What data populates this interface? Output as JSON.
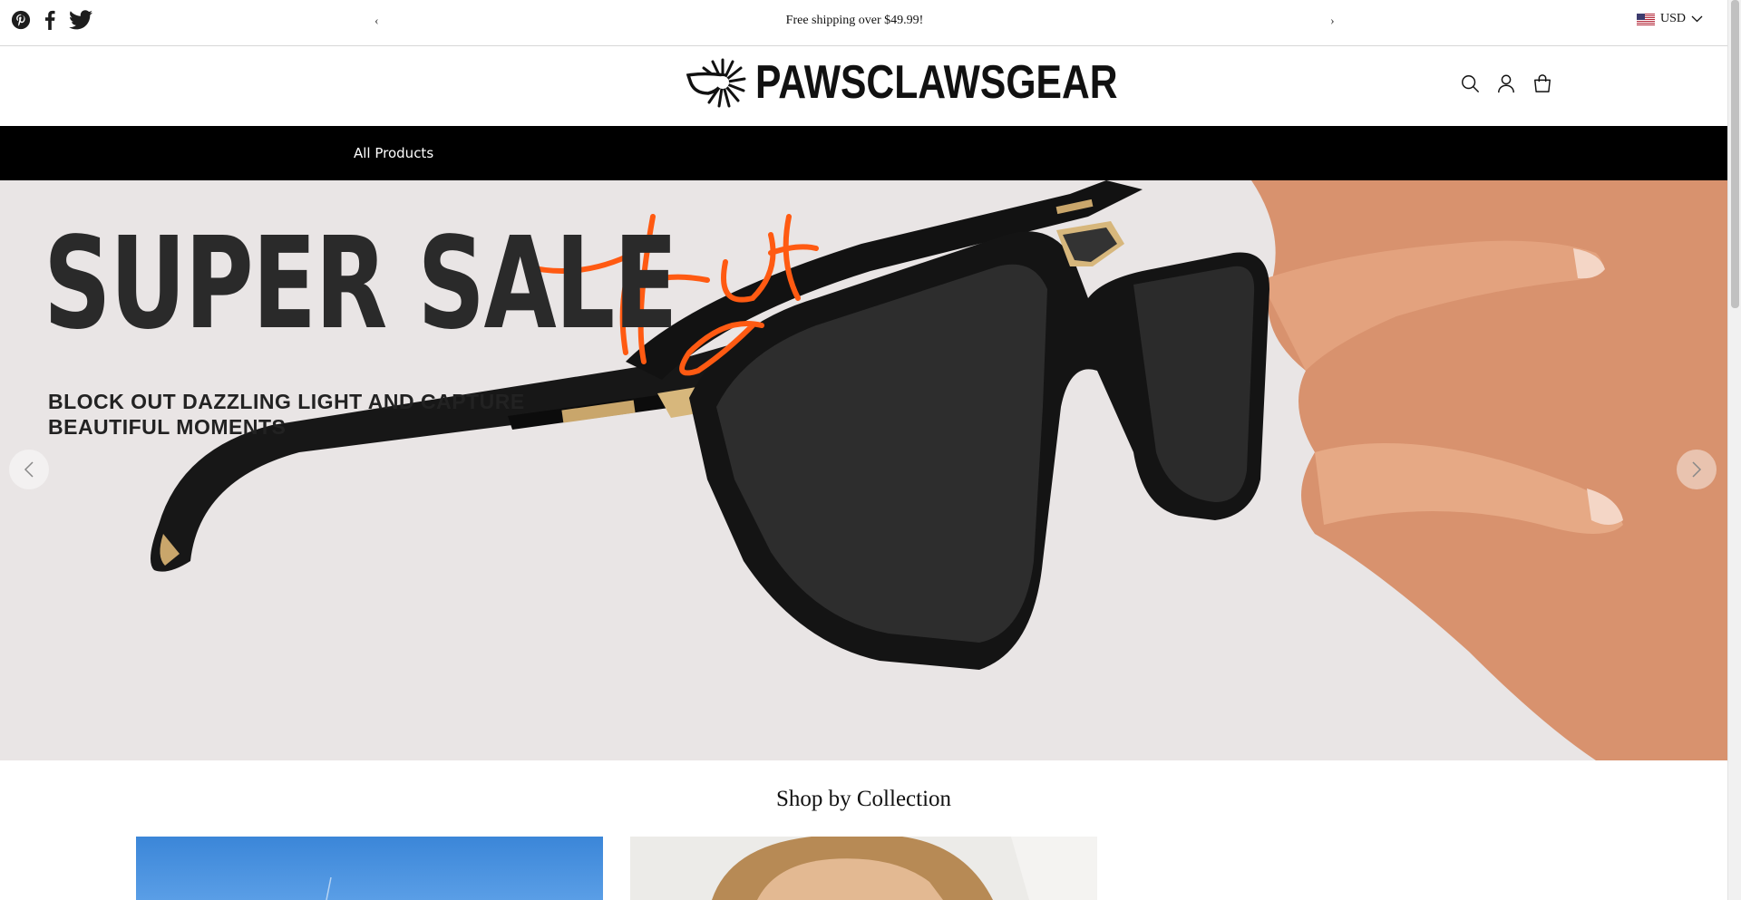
{
  "topbar": {
    "social": [
      {
        "icon": "pinterest-icon"
      },
      {
        "icon": "facebook-icon"
      },
      {
        "icon": "twitter-icon"
      }
    ],
    "announcement_prev": "‹",
    "announcement": "Free shipping over $49.99!",
    "announcement_next": "›",
    "currency": "USD"
  },
  "header": {
    "logo_text": "PAWSCLAWSGEAR",
    "icons": [
      "search-icon",
      "account-icon",
      "cart-icon"
    ]
  },
  "nav": {
    "items": [
      {
        "label": "All Products"
      }
    ]
  },
  "hero": {
    "title": "SUPER SALE",
    "script_word": "Hot",
    "subtitle_line1": "BLOCK OUT DAZZLING LIGHT AND CAPTURE",
    "subtitle_line2": "BEAUTIFUL MOMENTS"
  },
  "collections": {
    "title": "Shop by Collection"
  },
  "colors": {
    "nav_bg": "#000000",
    "hero_bg": "#e9e5e5",
    "accent": "#ff5a12"
  }
}
